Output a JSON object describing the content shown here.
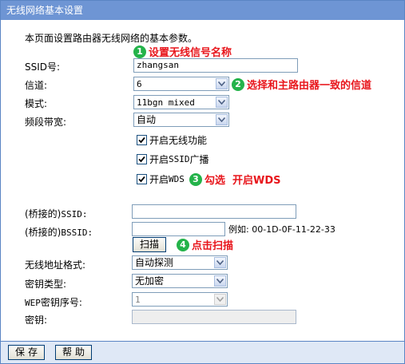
{
  "title": "无线网络基本设置",
  "intro": "本页面设置路由器无线网络的基本参数。",
  "fields": {
    "ssid_label": "SSID号:",
    "ssid_value": "zhangsan",
    "channel_label": "信道:",
    "channel_value": "6",
    "mode_label": "模式:",
    "mode_value": "11bgn mixed",
    "bandwidth_label": "频段带宽:",
    "bandwidth_value": "自动"
  },
  "checkboxes": {
    "enable_wireless": {
      "label": "开启无线功能",
      "checked": true
    },
    "enable_ssid_broadcast": {
      "label_prefix": "开启",
      "label_mono": "SSID",
      "label_suffix": "广播",
      "checked": true
    },
    "enable_wds": {
      "label_prefix": "开启",
      "label_mono": "WDS",
      "checked": true
    }
  },
  "bridge": {
    "ssid_label_prefix": "(桥接的)",
    "ssid_label_mono": "SSID:",
    "ssid_value": "",
    "bssid_label_prefix": "(桥接的)",
    "bssid_label_mono": "BSSID:",
    "bssid_value": "",
    "bssid_example": "例如: 00-1D-0F-11-22-33",
    "scan_button": "扫描"
  },
  "security": {
    "address_format_label": "无线地址格式:",
    "address_format_value": "自动探测",
    "key_type_label": "密钥类型:",
    "key_type_value": "无加密",
    "wep_index_label_mono": "WEP",
    "wep_index_label": "密钥序号:",
    "wep_index_value": "1",
    "key_label": "密钥:",
    "key_value": ""
  },
  "annotations": [
    {
      "num": "1",
      "text": "设置无线信号名称"
    },
    {
      "num": "2",
      "text": "选择和主路由器一致的信道"
    },
    {
      "num": "3",
      "text": "勾选  开启WDS"
    },
    {
      "num": "4",
      "text": "点击扫描"
    }
  ],
  "footer": {
    "save_button": "保存",
    "help_button": "帮助"
  },
  "colors": {
    "titlebar": "#6e95d4",
    "annotation_text": "#e8161c",
    "annotation_badge": "#24b34a",
    "footer_bg": "#dfe8f6"
  }
}
